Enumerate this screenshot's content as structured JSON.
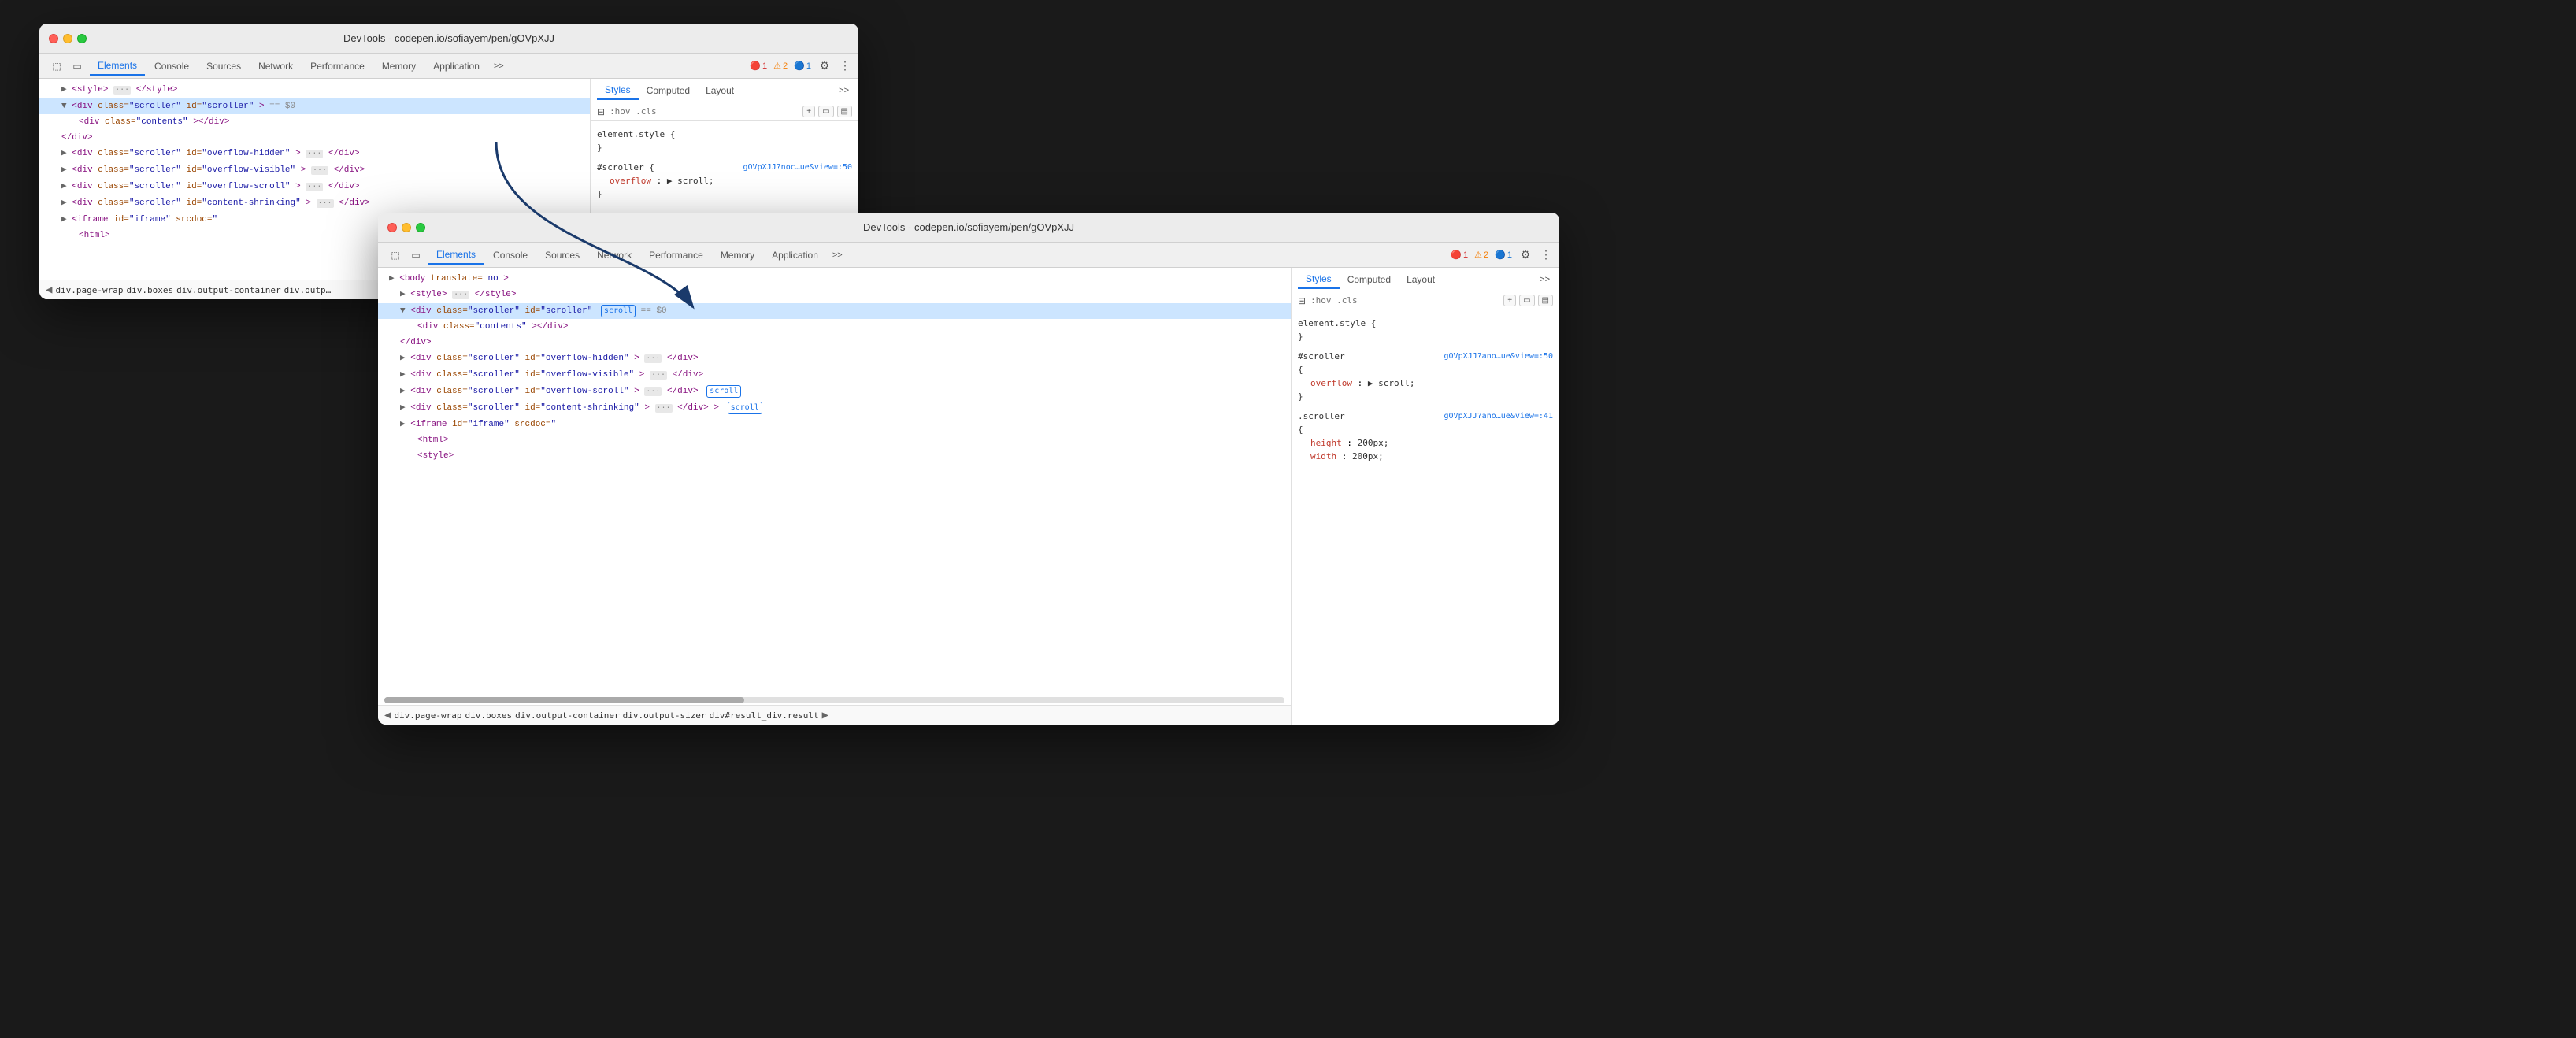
{
  "window1": {
    "title": "DevTools - codepen.io/sofiayem/pen/gOVpXJJ",
    "tabs": [
      "Elements",
      "Console",
      "Sources",
      "Network",
      "Performance",
      "Memory",
      "Application"
    ],
    "active_tab": "Elements",
    "badges": {
      "error": "1",
      "warning": "2",
      "info": "1"
    },
    "elements": [
      {
        "text": "▶ <style> ··· </style>",
        "indent": 0,
        "type": "style"
      },
      {
        "text": "▼ <div class=\"scroller\" id=\"scroller\"> == $0",
        "indent": 0,
        "type": "selected",
        "id": "scroller"
      },
      {
        "text": "<div class=\"contents\"></div>",
        "indent": 1,
        "type": "normal"
      },
      {
        "text": "</div>",
        "indent": 0,
        "type": "normal"
      },
      {
        "text": "▶ <div class=\"scroller\" id=\"overflow-hidden\"> ··· </div>",
        "indent": 0,
        "type": "normal"
      },
      {
        "text": "▶ <div class=\"scroller\" id=\"overflow-visible\"> ··· </div>",
        "indent": 0,
        "type": "normal"
      },
      {
        "text": "▶ <div class=\"scroller\" id=\"overflow-scroll\"> ··· </div>",
        "indent": 0,
        "type": "normal"
      },
      {
        "text": "▶ <div class=\"scroller\" id=\"content-shrinking\"> ··· </div>",
        "indent": 0,
        "type": "normal"
      },
      {
        "text": "▶ <iframe id=\"iframe\" srcdoc=\"",
        "indent": 0,
        "type": "normal"
      },
      {
        "text": "<html>",
        "indent": 1,
        "type": "normal"
      }
    ],
    "breadcrumb": [
      "div.page-wrap",
      "div.boxes",
      "div.output-container",
      "div.outp…"
    ],
    "styles": {
      "filter_placeholder": ":hov .cls",
      "rules": [
        {
          "selector": "element.style {",
          "close": "}",
          "props": []
        },
        {
          "selector": "#scroller {",
          "origin": "gOVpXJJ?noc…ue&view=:50",
          "close": "}",
          "props": [
            {
              "name": "overflow",
              "value": "▶ scroll;",
              "color": "red"
            }
          ]
        }
      ]
    }
  },
  "window2": {
    "title": "DevTools - codepen.io/sofiayem/pen/gOVpXJJ",
    "tabs": [
      "Elements",
      "Console",
      "Sources",
      "Network",
      "Performance",
      "Memory",
      "Application"
    ],
    "active_tab": "Elements",
    "badges": {
      "error": "1",
      "warning": "2",
      "info": "1"
    },
    "elements": [
      {
        "text": "▶ <body translate= no >",
        "indent": 0
      },
      {
        "text": "▶ <style> ··· </style>",
        "indent": 1
      },
      {
        "text": "▼ <div class=\"scroller\" id=\"scroller\"",
        "indent": 1,
        "scroll": true,
        "selected": true
      },
      {
        "text": "<div class=\"contents\"></div>",
        "indent": 2
      },
      {
        "text": "</div>",
        "indent": 1
      },
      {
        "text": "▶ <div class=\"scroller\" id=\"overflow-hidden\"> ··· </div>",
        "indent": 1
      },
      {
        "text": "▶ <div class=\"scroller\" id=\"overflow-visible\"> ··· </div>",
        "indent": 1
      },
      {
        "text": "▶ <div class=\"scroller\" id=\"overflow-scroll\"> ··· </div>",
        "indent": 1,
        "scroll": true
      },
      {
        "text": "▶ <div class=\"scroller\" id=\"content-shrinking\"> ··· </div>",
        "indent": 1,
        "scroll2": true
      },
      {
        "text": "▶ <iframe id=\"iframe\" srcdoc=\"",
        "indent": 1
      },
      {
        "text": "<html>",
        "indent": 2
      },
      {
        "text": "<style>",
        "indent": 2
      }
    ],
    "breadcrumb": [
      "div.page-wrap",
      "div.boxes",
      "div.output-container",
      "div.output-sizer",
      "div#result_div.result"
    ],
    "styles": {
      "filter_placeholder": ":hov .cls",
      "rules": [
        {
          "selector": "element.style {",
          "close": "}",
          "props": []
        },
        {
          "selector": "#scroller",
          "origin": "gOVpXJJ?ano…ue&view=:50",
          "brace": "{",
          "close": "}",
          "props": [
            {
              "name": "overflow",
              "value": "▶ scroll;",
              "color": "red"
            }
          ]
        },
        {
          "selector": ".scroller",
          "origin": "gOVpXJJ?ano…ue&view=:41",
          "brace": "{",
          "close": "",
          "props": [
            {
              "name": "height",
              "value": "200px;"
            },
            {
              "name": "width",
              "value": "200px;"
            }
          ]
        }
      ]
    }
  }
}
